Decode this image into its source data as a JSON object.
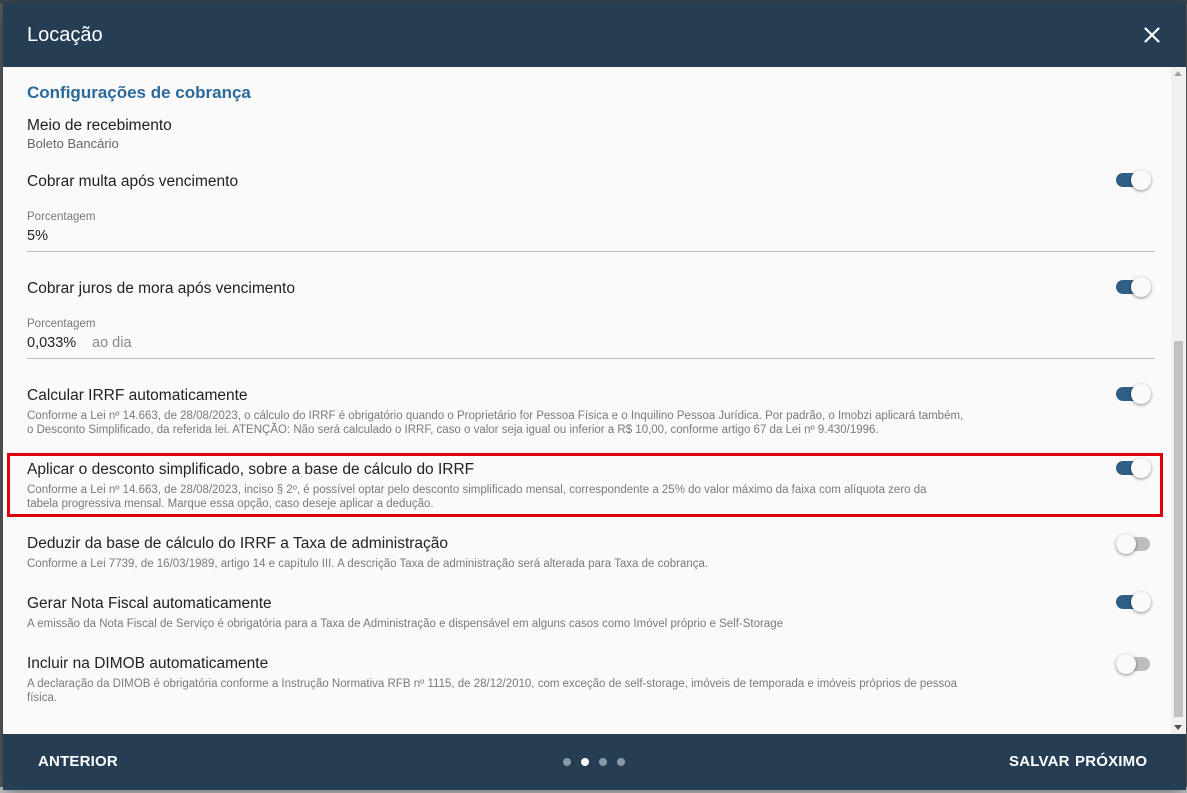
{
  "dialog": {
    "title": "Locação",
    "close_icon": "close-icon"
  },
  "section": {
    "title": "Configurações de cobrança"
  },
  "payment_method": {
    "label": "Meio de recebimento",
    "value": "Boleto Bancário"
  },
  "late_fee": {
    "title": "Cobrar multa após vencimento",
    "enabled": true,
    "field_label": "Porcentagem",
    "value": "5%"
  },
  "interest": {
    "title": "Cobrar juros de mora após vencimento",
    "enabled": true,
    "field_label": "Porcentagem",
    "value": "0,033%",
    "suffix": "ao dia"
  },
  "settings": [
    {
      "title": "Calcular IRRF automaticamente",
      "description": "Conforme a Lei nº 14.663, de 28/08/2023, o cálculo do IRRF é obrigatório quando o Proprietário for Pessoa Física e o Inquilino Pessoa Jurídica. Por padrão, o Imobzi aplicará também, o Desconto Simplificado, da referida lei. ATENÇÃO: Não será calculado o IRRF, caso o valor seja igual ou inferior a R$ 10,00, conforme artigo 67 da Lei nº 9.430/1996.",
      "enabled": true
    },
    {
      "title": "Aplicar o desconto simplificado, sobre a base de cálculo do IRRF",
      "description": "Conforme a Lei nº 14.663, de 28/08/2023, inciso § 2º, é possível optar pelo desconto simplificado mensal, correspondente a 25% do valor máximo da faixa com alíquota zero da tabela progressiva mensal. Marque essa opção, caso deseje aplicar a dedução.",
      "enabled": true
    },
    {
      "title": "Deduzir da base de cálculo do IRRF a Taxa de administração",
      "description": "Conforme a Lei 7739, de 16/03/1989, artigo 14 e capítulo III. A descrição Taxa de administração será alterada para Taxa de cobrança.",
      "enabled": false
    },
    {
      "title": "Gerar Nota Fiscal automaticamente",
      "description": "A emissão da Nota Fiscal de Serviço é obrigatória para a Taxa de Administração e dispensável em alguns casos como Imóvel próprio e Self-Storage",
      "enabled": true
    },
    {
      "title": "Incluir na DIMOB automaticamente",
      "description": "A declaração da DIMOB é obrigatória conforme a Instrução Normativa RFB nº 1115, de 28/12/2010, com exceção de self-storage, imóveis de temporada e imóveis próprios de pessoa física.",
      "enabled": false
    }
  ],
  "footer": {
    "previous_label": "ANTERIOR",
    "save_label": "SALVAR",
    "next_label": "PRÓXIMO",
    "steps_total": 4,
    "active_step": 2
  },
  "colors": {
    "header_bg": "#263e54",
    "accent": "#2a6a9a",
    "toggle_on": "#2f5f87",
    "highlight": "#e0000b"
  }
}
